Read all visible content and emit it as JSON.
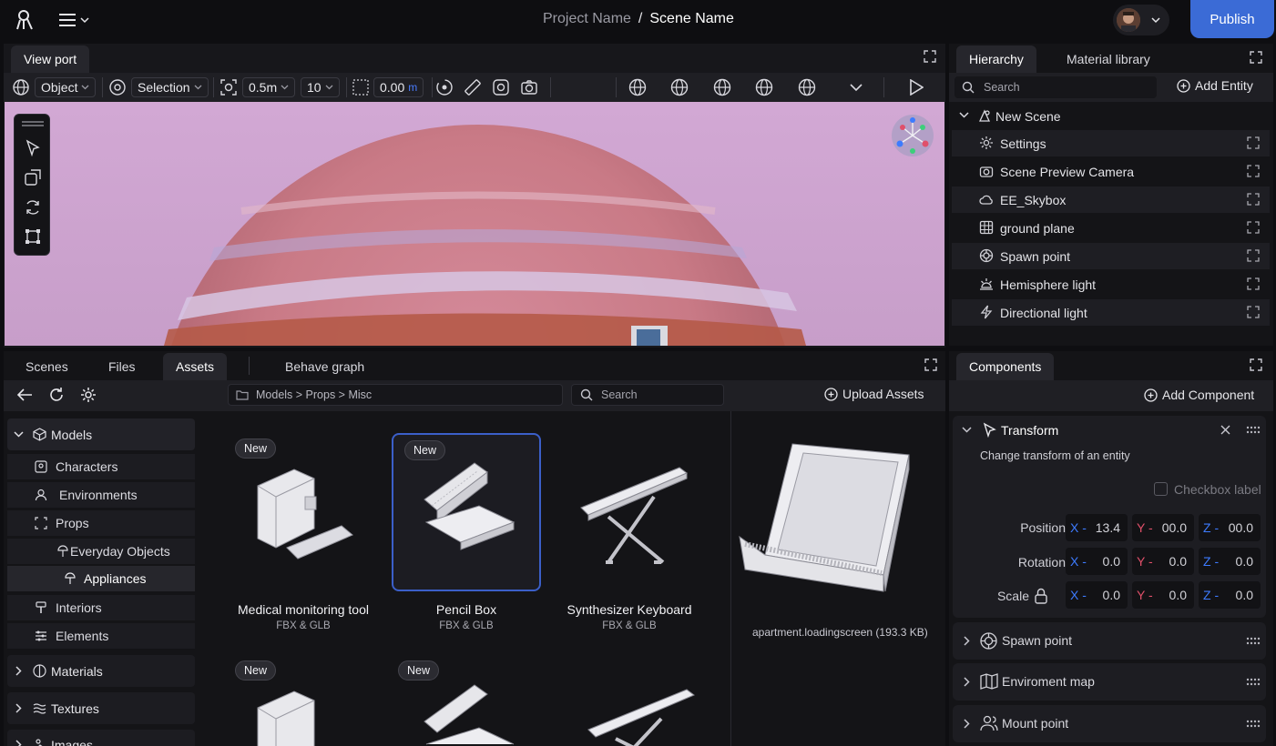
{
  "topbar": {
    "project_name": "Project Name",
    "separator": "/",
    "scene_name": "Scene Name",
    "publish_label": "Publish"
  },
  "viewport": {
    "tab_label": "View port",
    "mode_select": "Object",
    "selection_select": "Selection",
    "snap_distance": "0.5m",
    "snap_count": "10",
    "value_field": "0.00",
    "value_unit": "m"
  },
  "hierarchy": {
    "tabs": [
      "Hierarchy",
      "Material library"
    ],
    "search_placeholder": "Search",
    "add_entity_label": "Add Entity",
    "root_label": "New Scene",
    "items": [
      {
        "label": "Settings",
        "icon": "gear-icon"
      },
      {
        "label": "Scene Preview Camera",
        "icon": "camera-icon"
      },
      {
        "label": "EE_Skybox",
        "icon": "cloud-icon"
      },
      {
        "label": "ground plane",
        "icon": "grid-icon"
      },
      {
        "label": "Spawn point",
        "icon": "spawn-icon"
      },
      {
        "label": "Hemisphere light",
        "icon": "sun-icon"
      },
      {
        "label": "Directional light",
        "icon": "bolt-icon"
      }
    ]
  },
  "bottom": {
    "tabs": [
      "Scenes",
      "Files",
      "Assets",
      "Behave graph"
    ],
    "breadcrumb": "Models > Props > Misc",
    "search_placeholder": "Search",
    "upload_label": "Upload Assets",
    "sidebar": {
      "models": "Models",
      "characters": "Characters",
      "environments": "Environments",
      "props": "Props",
      "everyday_objects": "Everyday Objects",
      "appliances": "Appliances",
      "interiors": "Interiors",
      "elements": "Elements",
      "materials": "Materials",
      "textures": "Textures",
      "images": "Images"
    },
    "badge_new": "New",
    "assets": [
      {
        "name": "Medical monitoring tool",
        "format": "FBX & GLB"
      },
      {
        "name": "Pencil Box",
        "format": "FBX & GLB"
      },
      {
        "name": "Synthesizer Keyboard",
        "format": "FBX & GLB"
      }
    ],
    "preview_caption": "apartment.loadingscreen (193.3 KB)"
  },
  "components": {
    "tab_label": "Components",
    "add_label": "Add Component",
    "transform": {
      "title": "Transform",
      "description": "Change transform of an entity",
      "checkbox_label": "Checkbox label",
      "position_label": "Position",
      "rotation_label": "Rotation",
      "scale_label": "Scale",
      "axis_x": "X -",
      "axis_y": "Y -",
      "axis_z": "Z -",
      "position": [
        "13.4",
        "00.0",
        "00.0"
      ],
      "rotation": [
        "0.0",
        "0.0",
        "0.0"
      ],
      "scale": [
        "0.0",
        "0.0",
        "0.0"
      ]
    },
    "collapsed": [
      "Spawn point",
      "Enviroment map",
      "Mount point"
    ]
  },
  "colors": {
    "accent": "#3b6bd6",
    "axis_x": "#3d7bff",
    "axis_y": "#e0506a",
    "axis_z": "#3d7bff"
  }
}
